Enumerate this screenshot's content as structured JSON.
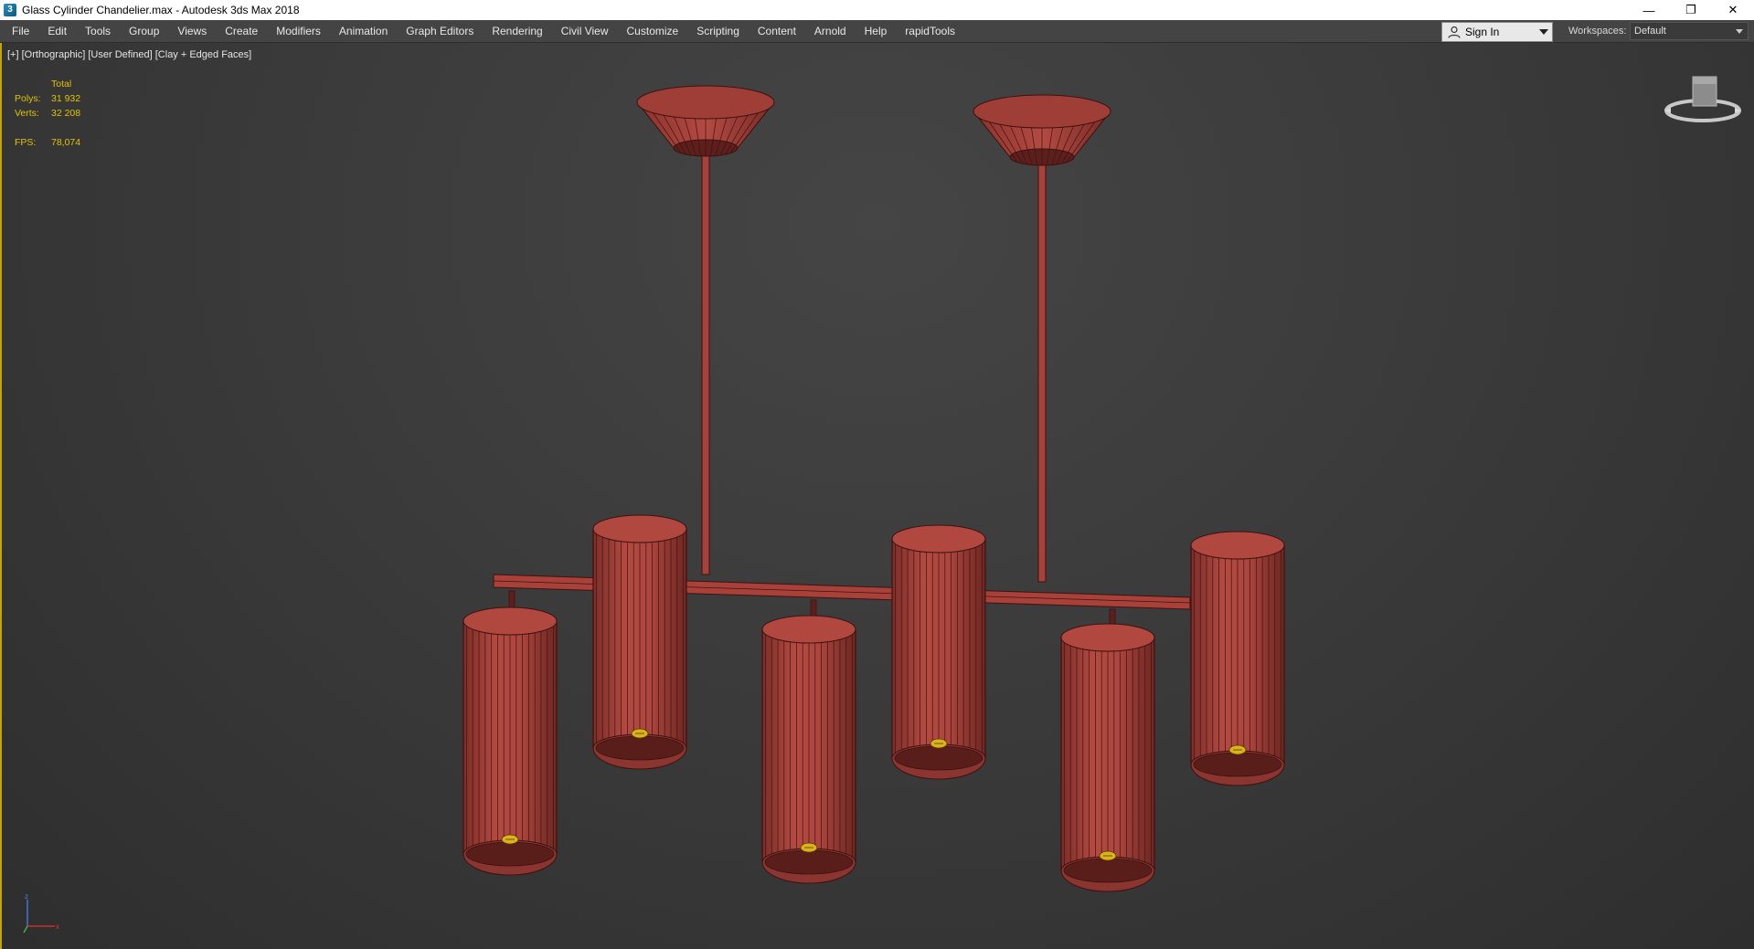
{
  "window": {
    "title": "Glass Cylinder Chandelier.max - Autodesk 3ds Max 2018",
    "app_icon": "3ds-max-icon",
    "controls": {
      "minimize": "—",
      "restore": "❐",
      "close": "✕"
    }
  },
  "menubar": {
    "items": [
      "File",
      "Edit",
      "Tools",
      "Group",
      "Views",
      "Create",
      "Modifiers",
      "Animation",
      "Graph Editors",
      "Rendering",
      "Civil View",
      "Customize",
      "Scripting",
      "Content",
      "Arnold",
      "Help",
      "rapidTools"
    ],
    "signin_label": "Sign In",
    "workspaces_label": "Workspaces:",
    "workspaces_value": "Default"
  },
  "viewport": {
    "label_plus": "[+]",
    "label_view": "[Orthographic]",
    "label_camera": "[User Defined]",
    "label_shading": "[Clay + Edged Faces]",
    "stats": {
      "header": "Total",
      "polys_label": "Polys:",
      "polys_value": "31 932",
      "verts_label": "Verts:",
      "verts_value": "32 208",
      "fps_label": "FPS:",
      "fps_value": "78,074"
    },
    "colors": {
      "accent_border": "#c9a400",
      "stats_text": "#e0c400",
      "model_fill": "#a8413a",
      "model_edge": "#4a1512"
    }
  }
}
